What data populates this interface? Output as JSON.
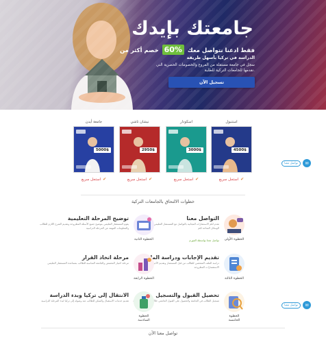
{
  "hero": {
    "title": "جامعتك بإيدك",
    "line1_prefix": "خصم أكثر من",
    "line1_badge": "60%",
    "line1_suffix": "فقط ادعنا نتواصل معك",
    "line2": "الدراسة في تركيا بأسهل طريقة",
    "line3": "سجل في جامعة مستقلة من الفروع والخصومات الحصرية التي",
    "line4": "نقدمها للجامعات التركية للطلبة.",
    "cta_label": "تسجيل الآن"
  },
  "cards": [
    {
      "label": "جامعة أيدن",
      "price": "5000$",
      "register": "استجل سريع",
      "bg": "#2740a2"
    },
    {
      "label": "نيشان تاشي",
      "price": "2950$",
      "register": "استجل سريع",
      "bg": "#b52a2a"
    },
    {
      "label": "اسكودار",
      "price": "3000$",
      "register": "استجل سريع",
      "bg": "#1a9a8e"
    },
    {
      "label": "استنبول",
      "price": "4500$",
      "register": "استجل سريع",
      "bg": "#243a8a"
    }
  ],
  "fab": {
    "label": "تواصل معنا"
  },
  "steps_section": {
    "title": "خطوات الالتحاق بالجامعات التركية",
    "steps": [
      {
        "name": "الخطوة الأولى",
        "title": "التواصل معنا",
        "desc": "نقدم لكم الاستشارات المجانية بالتواصل مع المستشار التعليمي الخاص بكم عبر الوسائل المتاحة لكم",
        "more": "تواصل معنا بواسطة الفورم"
      },
      {
        "name": "الخطوة الثانية",
        "title": "توضيح المرحلة التعليمية",
        "desc": "يقوم المستشار التعليمي بتوضيح جميع الأسئلة المطروحة وتقديم الشرح اللازم للطالب والمعلومات المهمة عن المرحلة الدراسية",
        "more": ""
      },
      {
        "name": "الخطوة الثالثة",
        "title": "تقديم الإجابات ودراسة الملف",
        "desc": "دراسة الملف الشخصي للطالب من قبل المستشار وتقديم الأجوبة على جميع الاستفسارات المطروحة",
        "more": ""
      },
      {
        "name": "الخطوة الرابعة",
        "title": "مرحلة اتخاذ القرار",
        "desc": "مرحلة اختيار التخصص والجامعة المناسبة للطالب بمساعدة المستشار التعليمي",
        "more": ""
      },
      {
        "name": "الخطوة الخامسة",
        "title": "تحصيل القبول والتسجيل",
        "desc": "تسجيل الطالب في الجامعة والحصول على القبول الجامعي خلال فترة زمنية قصيرة",
        "more": ""
      },
      {
        "name": "الخطوة السادسة",
        "title": "الانتقال إلى تركيا وبدء الدراسة",
        "desc": "تقديم خدمات الاستقبال والسكن للطالب عند وصوله إلى تركيا لبدء المرحلة الدراسية",
        "more": ""
      }
    ]
  },
  "footer": {
    "title": "تواصل معنا الآن"
  },
  "colors": {
    "accent": "#2852b4",
    "green": "#6fbe3c",
    "red": "#d7393d",
    "fab": "#2f9ad8"
  }
}
